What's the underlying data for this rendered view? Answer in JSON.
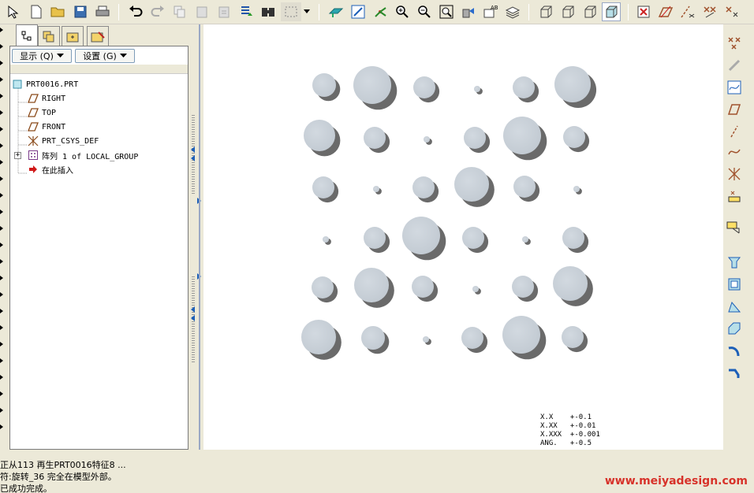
{
  "toolbar": {
    "icons": [
      "select-icon",
      "new-file-icon",
      "open-folder-icon",
      "save-icon",
      "print-icon",
      "undo-icon",
      "redo-icon",
      "copy-icon",
      "paste-icon",
      "paste-special-icon",
      "regenerate-icon",
      "find-icon",
      "box-select-icon",
      "dropdown-icon",
      "repaint-icon",
      "orient-icon",
      "spin-center-icon",
      "zoom-in-icon",
      "zoom-out-icon",
      "refit-icon",
      "view-manager-icon",
      "saved-views-icon",
      "layers-icon",
      "wireframe-icon",
      "hidden-line-icon",
      "no-hidden-icon",
      "shading-icon",
      "datum-plane-toggle-icon",
      "datum-axis-toggle-icon",
      "datum-point-toggle-icon",
      "csys-toggle-icon"
    ]
  },
  "tabs": [
    "model-tree-tab",
    "layer-tree-tab",
    "folder-browser-tab",
    "favorites-tab"
  ],
  "panel": {
    "show_label": "显示 (Q)",
    "settings_label": "设置 (G)"
  },
  "tree": [
    {
      "label": "PRT0016.PRT",
      "icon": "part-icon"
    },
    {
      "label": "RIGHT",
      "icon": "datum-plane-icon"
    },
    {
      "label": "TOP",
      "icon": "datum-plane-icon"
    },
    {
      "label": "FRONT",
      "icon": "datum-plane-icon"
    },
    {
      "label": "PRT_CSYS_DEF",
      "icon": "csys-icon"
    },
    {
      "label": "阵列 1 of LOCAL_GROUP",
      "icon": "pattern-icon"
    },
    {
      "label": "在此插入",
      "icon": "insert-here-arrow-icon"
    }
  ],
  "tolerances": [
    "X.X    +-0.1",
    "X.XX   +-0.01",
    "X.XXX  +-0.001",
    "ANG.   +-0.5"
  ],
  "messages": [
    "正从113 再生PRT0016特征8 ...",
    "符:旋转_36 完全在模型外部。",
    "已成功完成。"
  ],
  "watermark": "www.meiyadesign.com",
  "right_toolbar": [
    "datum-point-icon",
    "datum-axis-icon",
    "sketch-curve-icon",
    "datum-plane-icon",
    "axis-icon",
    "curve-icon",
    "csys-icon",
    "analysis-icon",
    "annotation-icon",
    "extrude-icon",
    "hole-icon",
    "draft-icon",
    "shell-icon",
    "round-icon",
    "chamfer-icon"
  ],
  "colors": {
    "sphere": "#c3cbd3",
    "shadow": "#6a6a6a",
    "accent": "#1c5fb8"
  }
}
